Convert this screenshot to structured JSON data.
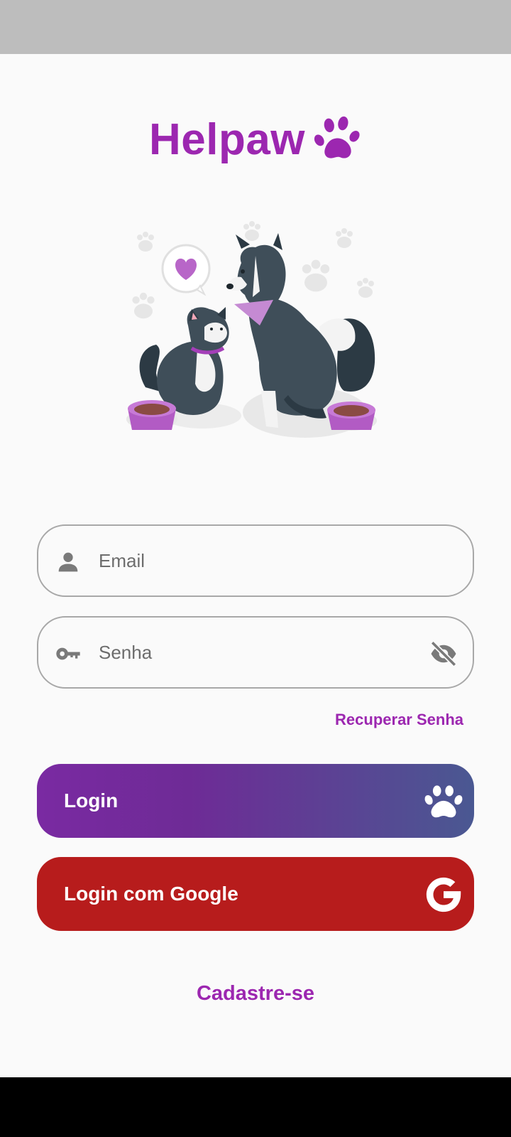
{
  "app": {
    "name": "Helpaw"
  },
  "email": {
    "placeholder": "Email"
  },
  "password": {
    "placeholder": "Senha"
  },
  "recover_link": "Recuperar Senha",
  "login_button": "Login",
  "google_button": "Login com Google",
  "signup_link": "Cadastre-se",
  "colors": {
    "brand_purple": "#9c27b0",
    "login_gradient_start": "#7a2aa2",
    "login_gradient_end": "#4a5892",
    "google_red": "#b71c1c",
    "field_border": "#a8a8a8"
  },
  "icons": {
    "logo": "paw-icon",
    "email": "person-icon",
    "password": "key-icon",
    "visibility": "eye-off-icon",
    "login": "paw-icon",
    "google": "google-icon"
  }
}
